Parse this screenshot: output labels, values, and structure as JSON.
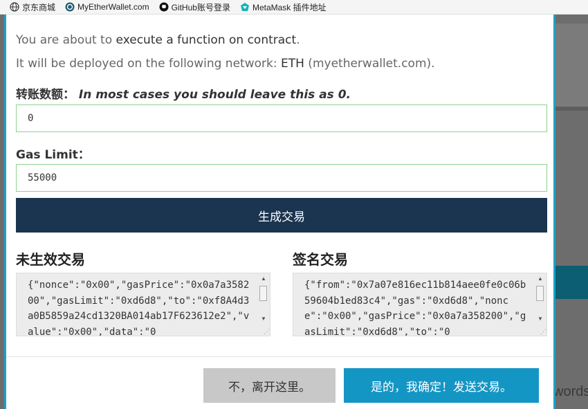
{
  "bookmarks": [
    {
      "label": "京东商城",
      "icon": "globe-icon"
    },
    {
      "label": "MyEtherWallet.com",
      "icon": "mew-icon"
    },
    {
      "label": "GitHub账号登录",
      "icon": "github-icon"
    },
    {
      "label": "MetaMask 插件地址",
      "icon": "metamask-icon"
    }
  ],
  "background": {
    "partial_text": "words"
  },
  "modal": {
    "intro_prefix": "You are about to ",
    "intro_action": "execute a function on contract",
    "intro_suffix": ".",
    "network_prefix": "It will be deployed on the following network: ",
    "network_name": "ETH",
    "network_suffix": " (myetherwallet.com).",
    "amount_label": "转账数额：",
    "amount_hint": "In most cases you should leave this as 0.",
    "amount_value": "0",
    "gas_label": "Gas Limit：",
    "gas_value": "55000",
    "generate_button": "生成交易",
    "raw_title": "未生效交易",
    "raw_tx": "{\"nonce\":\"0x00\",\"gasPrice\":\"0x0a7a358200\",\"gasLimit\":\"0xd6d8\",\"to\":\"0xf8A4d3a0B5859a24cd1320BA014ab17F623612e2\",\"value\":\"0x00\",\"data\":\"0",
    "signed_title": "签名交易",
    "signed_tx": "{\"from\":\"0x7a07e816ec11b814aee0fe0c06b59604b1ed83c4\",\"gas\":\"0xd6d8\",\"nonce\":\"0x00\",\"gasPrice\":\"0x0a7a358200\",\"gasLimit\":\"0xd6d8\",\"to\":\"0",
    "cancel_button": "不，离开这里。",
    "confirm_button": "是的，我确定！发送交易。"
  },
  "colors": {
    "accent": "#1496c5",
    "primary_dark": "#1b3450",
    "input_border": "#8fd28f"
  }
}
